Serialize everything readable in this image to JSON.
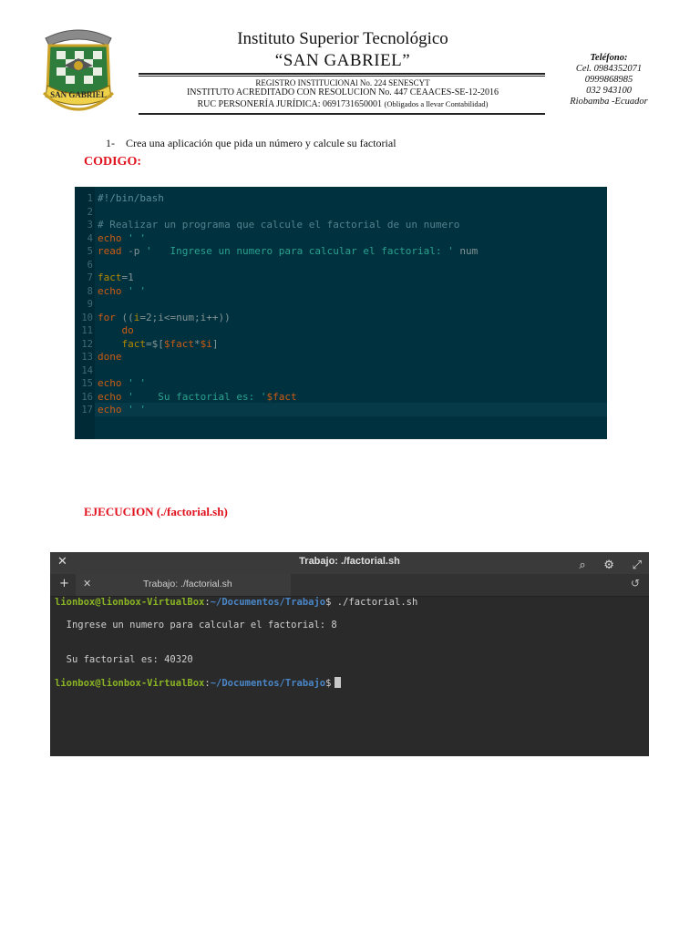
{
  "header": {
    "title": "Instituto Superior Tecnológico",
    "subtitle": "“SAN GABRIEL”",
    "logo_text": "SAN GABRIEL",
    "registro": "REGISTRO INSTITUCIONAl  No. 224  SENESCYT",
    "acreditado": "INSTITUTO ACREDITADO CON RESOLUCION No. 447 CEAACES-SE-12-2016",
    "ruc": "RUC  PERSONERÍA JURÍDICA: 0691731650001",
    "ruc_note": "(Obligados a llevar Contabilidad)",
    "phone_label": "Teléfono:",
    "phone_cel": "Cel.  0984352071",
    "phone_2": "0999868985",
    "phone_3": "032 943100",
    "location": "Riobamba -Ecuador"
  },
  "task": {
    "number": "1-",
    "text": "Crea una aplicación que pida un número y calcule su factorial"
  },
  "codigo_label": "CODIGO:",
  "code": {
    "line_numbers": [
      "1",
      "2",
      "3",
      "4",
      "5",
      "6",
      "7",
      "8",
      "9",
      "10",
      "11",
      "12",
      "13",
      "14",
      "15",
      "16",
      "17"
    ],
    "l1": "#!/bin/bash",
    "l3": "# Realizar un programa que calcule el factorial de un numero",
    "l4_kw": "echo",
    "l4_str": " ' '",
    "l5_kw": "read",
    "l5_flag": " -p ",
    "l5_str": "'   Ingrese un numero para calcular el factorial: '",
    "l5_var": " num",
    "l7_var": "fact",
    "l7_rest": "=1",
    "l8_kw": "echo",
    "l8_str": " ' '",
    "l10_kw": "for",
    "l10_rest": " ((",
    "l10_i": "i",
    "l10_rest2": "=2;i<=num;i++))",
    "l11_kw": "    do",
    "l12_var": "    fact",
    "l12_rest": "=$[",
    "l12_v1": "$fact",
    "l12_op": "*",
    "l12_v2": "$i",
    "l12_end": "]",
    "l13_kw": "done",
    "l15_kw": "echo",
    "l15_str": " ' '",
    "l16_kw": "echo",
    "l16_str": " '    Su factorial es: '",
    "l16_var": "$fact",
    "l17_kw": "echo",
    "l17_str": " ' '"
  },
  "ejecucion_label": "EJECUCION (./factorial.sh)",
  "terminal": {
    "close_icon": "✕",
    "title": "Trabajo: ./factorial.sh",
    "tab_label": "Trabajo: ./factorial.sh",
    "prompt_user": "lionbox@lionbox-VirtualBox",
    "prompt_sep": ":",
    "prompt_path": "~/Documentos/Trabajo",
    "prompt_dollar": "$",
    "command": " ./factorial.sh",
    "output_1": "  Ingrese un numero para calcular el factorial: 8",
    "output_2": "  Su factorial es: 40320"
  }
}
